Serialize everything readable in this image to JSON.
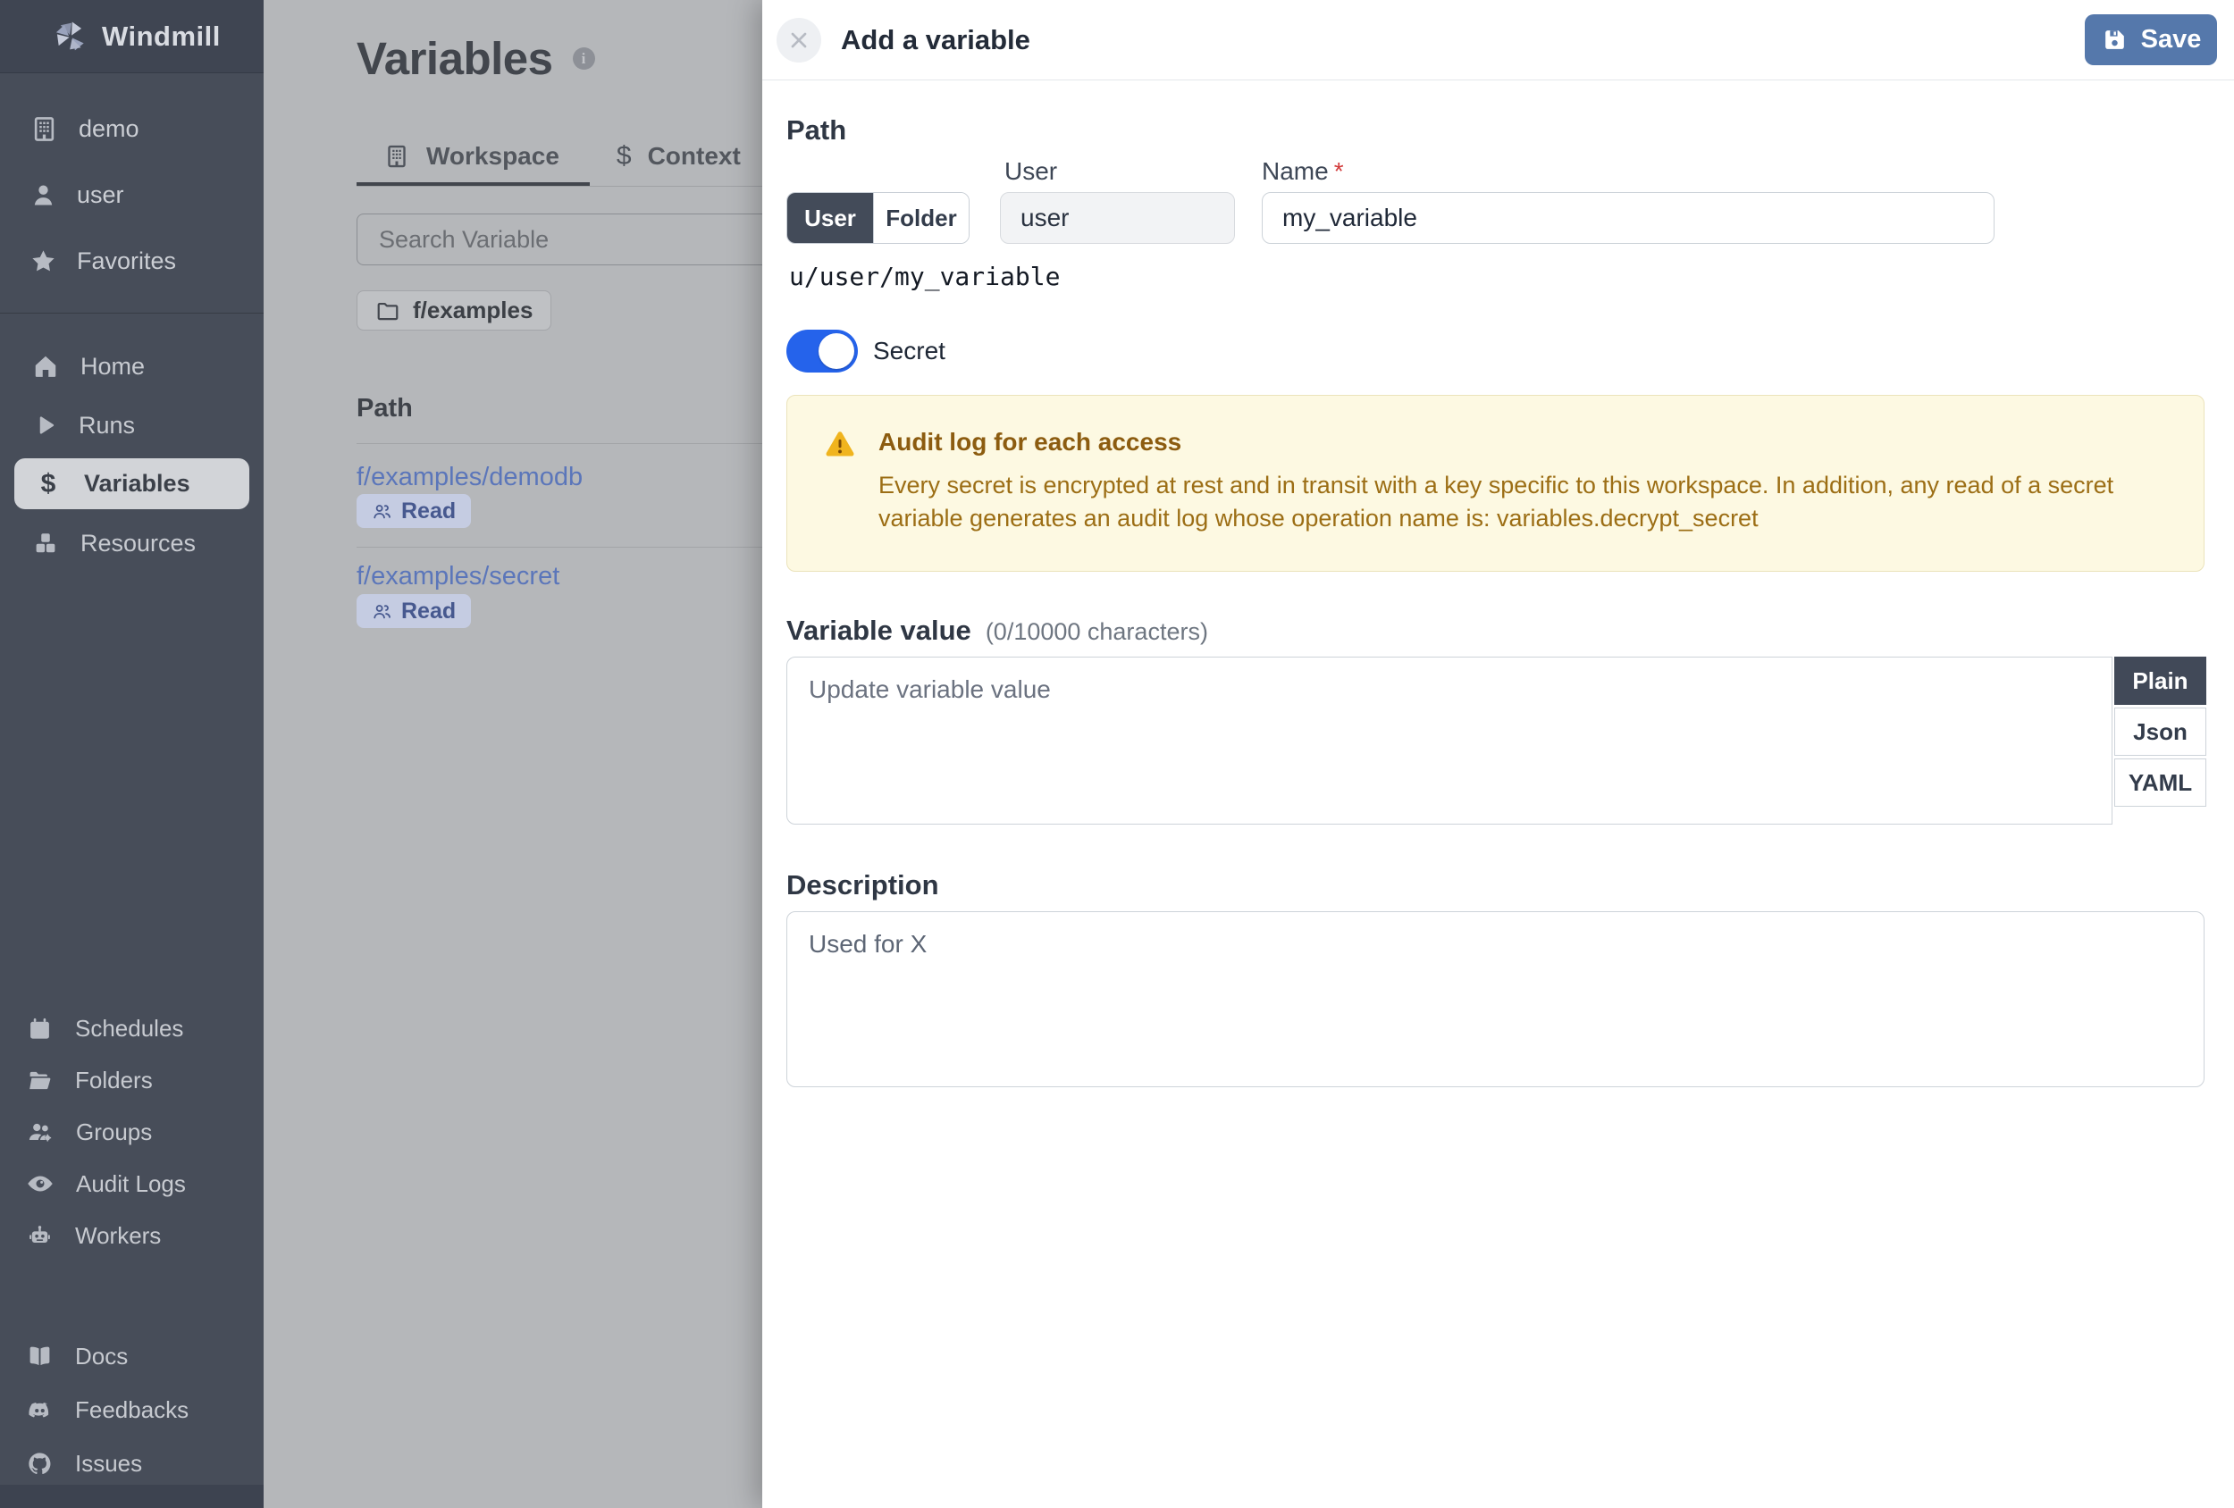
{
  "brand": {
    "name": "Windmill"
  },
  "colors": {
    "sidebar_bg": "#474d59",
    "sidebar_top_bg": "#3f4552",
    "selected_pill": "#d2d4d8",
    "save_button": "#5578ab",
    "toggle_on": "#2563eb",
    "warning_bg": "#fdf9e2",
    "warning_title": "#8c5c10",
    "warning_body": "#9c6e15",
    "link_blue": "#5b76ba",
    "badge_bg": "#c5cce2",
    "format_selected": "#414958"
  },
  "sidebar": {
    "workspace": {
      "label": "demo"
    },
    "account": {
      "label": "user"
    },
    "favorites": {
      "label": "Favorites"
    },
    "nav_main": [
      {
        "label": "Home"
      },
      {
        "label": "Runs"
      },
      {
        "label": "Variables",
        "active": true
      },
      {
        "label": "Resources"
      }
    ],
    "nav_admin": [
      {
        "label": "Schedules"
      },
      {
        "label": "Folders"
      },
      {
        "label": "Groups"
      },
      {
        "label": "Audit Logs"
      },
      {
        "label": "Workers"
      }
    ],
    "nav_help": [
      {
        "label": "Docs"
      },
      {
        "label": "Feedbacks"
      },
      {
        "label": "Issues"
      }
    ]
  },
  "main": {
    "title": "Variables",
    "tabs": [
      {
        "label": "Workspace",
        "active": true
      },
      {
        "label": "Context",
        "active": false
      }
    ],
    "search_placeholder": "Search Variable",
    "folder_chip": {
      "label": "f/examples"
    },
    "list": {
      "header": "Path",
      "rows": [
        {
          "path": "f/examples/demodb",
          "badge": "Read"
        },
        {
          "path": "f/examples/secret",
          "badge": "Read"
        }
      ]
    }
  },
  "drawer": {
    "title": "Add a variable",
    "save_label": "Save",
    "path": {
      "heading": "Path",
      "owner_kind": {
        "user": "User",
        "folder": "Folder",
        "selected": "User"
      },
      "user_label": "User",
      "user_value": "user",
      "name_label": "Name",
      "required_mark": "*",
      "name_value": "my_variable",
      "full_path": "u/user/my_variable"
    },
    "secret_label": "Secret",
    "secret_on": true,
    "warning": {
      "title": "Audit log for each access",
      "body": "Every secret is encrypted at rest and in transit with a key specific to this workspace. In addition, any read of a secret variable generates an audit log whose operation name is: variables.decrypt_secret"
    },
    "value": {
      "heading": "Variable value",
      "counter": "(0/10000 characters)",
      "placeholder": "Update variable value",
      "formats": [
        {
          "label": "Plain",
          "active": true
        },
        {
          "label": "Json",
          "active": false
        },
        {
          "label": "YAML",
          "active": false
        }
      ]
    },
    "description": {
      "heading": "Description",
      "placeholder": "Used for X"
    }
  }
}
